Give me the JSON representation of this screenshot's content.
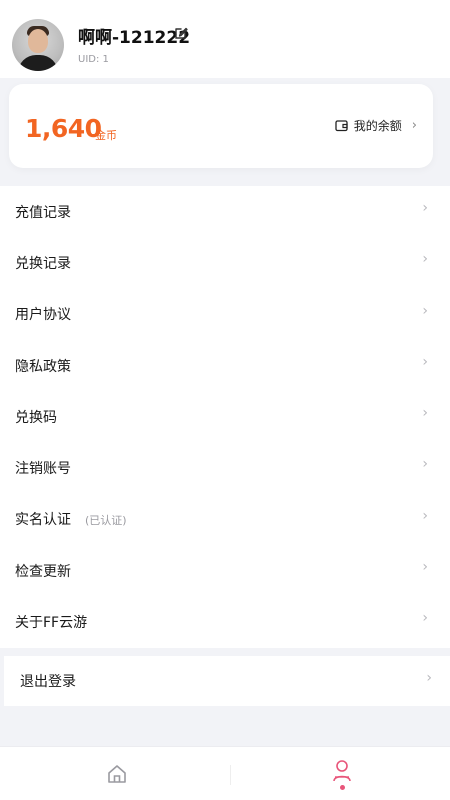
{
  "profile": {
    "username": "啊啊-121222",
    "uid": "UID: 1"
  },
  "balance": {
    "amount": "1,640",
    "unit": "金币",
    "link_label": "我的余额",
    "accent_color": "#f26522"
  },
  "menu": {
    "items": [
      {
        "label": "充值记录"
      },
      {
        "label": "兑换记录"
      },
      {
        "label": "用户协议"
      },
      {
        "label": "隐私政策"
      },
      {
        "label": "兑换码"
      },
      {
        "label": "注销账号"
      },
      {
        "label": "实名认证",
        "sub": "(已认证)"
      },
      {
        "label": "检查更新"
      },
      {
        "label": "关于FF云游"
      }
    ],
    "logout_label": "退出登录"
  },
  "icons": {
    "edit": "edit-icon",
    "wallet": "wallet-icon",
    "chevron": "chevron-right-icon",
    "home_tab": "home-icon",
    "me_tab": "user-icon"
  },
  "tabbar": {
    "active_color": "#e8557a"
  }
}
